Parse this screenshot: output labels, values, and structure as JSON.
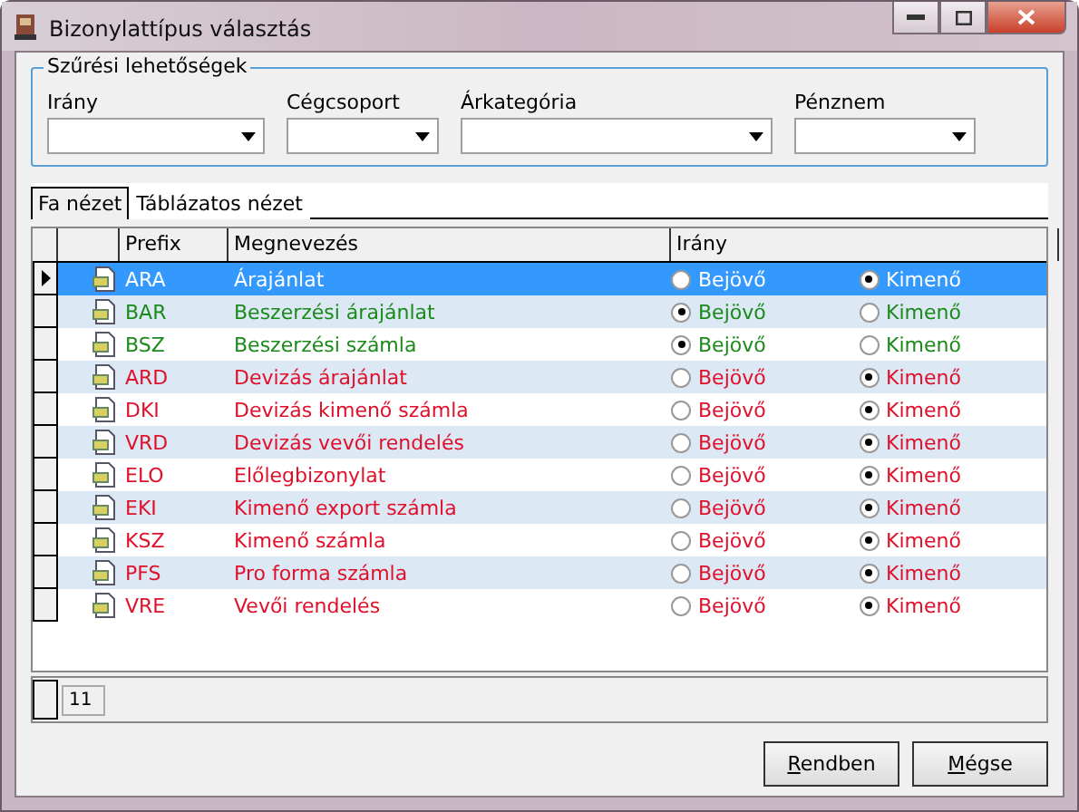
{
  "window": {
    "title": "Bizonylattípus választás"
  },
  "filters": {
    "title": "Szűrési lehetőségek",
    "fields": [
      {
        "label": "Irány"
      },
      {
        "label": "Cégcsoport"
      },
      {
        "label": "Árkategória"
      },
      {
        "label": "Pénznem"
      }
    ]
  },
  "tabs": [
    {
      "label": "Fa nézet",
      "selected": true
    },
    {
      "label": "Táblázatos nézet",
      "selected": false
    }
  ],
  "table": {
    "columns": [
      "Prefix",
      "Megnevezés",
      "Irány"
    ],
    "rows": [
      {
        "prefix": "ARA",
        "name": "Árajánlat",
        "selected": true,
        "directions": [
          {
            "label": "Bejövő",
            "selected": false
          },
          {
            "label": "Kimenő",
            "selected": true
          }
        ]
      },
      {
        "prefix": "BAR",
        "name": "Beszerzési árajánlat",
        "color": "#1a8a1a",
        "selected": false,
        "directions": [
          {
            "label": "Bejövő",
            "selected": true
          },
          {
            "label": "Kimenő",
            "selected": false
          }
        ]
      },
      {
        "prefix": "BSZ",
        "name": "Beszerzési számla",
        "color": "#1a8a1a",
        "selected": false,
        "directions": [
          {
            "label": "Bejövő",
            "selected": true
          },
          {
            "label": "Kimenő",
            "selected": false
          }
        ]
      },
      {
        "prefix": "ARD",
        "name": "Devizás árajánlat",
        "color": "#e0102a",
        "selected": false,
        "directions": [
          {
            "label": "Bejövő",
            "selected": false
          },
          {
            "label": "Kimenő",
            "selected": true
          }
        ]
      },
      {
        "prefix": "DKI",
        "name": "Devizás kimenő számla",
        "color": "#e0102a",
        "selected": false,
        "directions": [
          {
            "label": "Bejövő",
            "selected": false
          },
          {
            "label": "Kimenő",
            "selected": true
          }
        ]
      },
      {
        "prefix": "VRD",
        "name": "Devizás vevői rendelés",
        "color": "#e0102a",
        "selected": false,
        "directions": [
          {
            "label": "Bejövő",
            "selected": false
          },
          {
            "label": "Kimenő",
            "selected": true
          }
        ]
      },
      {
        "prefix": "ELO",
        "name": "Előlegbizonylat",
        "color": "#e0102a",
        "selected": false,
        "directions": [
          {
            "label": "Bejövő",
            "selected": false
          },
          {
            "label": "Kimenő",
            "selected": true
          }
        ]
      },
      {
        "prefix": "EKI",
        "name": "Kimenő export számla",
        "color": "#e0102a",
        "selected": false,
        "directions": [
          {
            "label": "Bejövő",
            "selected": false
          },
          {
            "label": "Kimenő",
            "selected": true
          }
        ]
      },
      {
        "prefix": "KSZ",
        "name": "Kimenő számla",
        "color": "#e0102a",
        "selected": false,
        "directions": [
          {
            "label": "Bejövő",
            "selected": false
          },
          {
            "label": "Kimenő",
            "selected": true
          }
        ]
      },
      {
        "prefix": "PFS",
        "name": "Pro forma számla",
        "color": "#e0102a",
        "selected": false,
        "directions": [
          {
            "label": "Bejövő",
            "selected": false
          },
          {
            "label": "Kimenő",
            "selected": true
          }
        ]
      },
      {
        "prefix": "VRE",
        "name": "Vevői rendelés",
        "color": "#e0102a",
        "selected": false,
        "directions": [
          {
            "label": "Bejövő",
            "selected": false
          },
          {
            "label": "Kimenő",
            "selected": true
          }
        ]
      }
    ],
    "count": "11"
  },
  "buttons": [
    "Rendben",
    "Mégse"
  ]
}
